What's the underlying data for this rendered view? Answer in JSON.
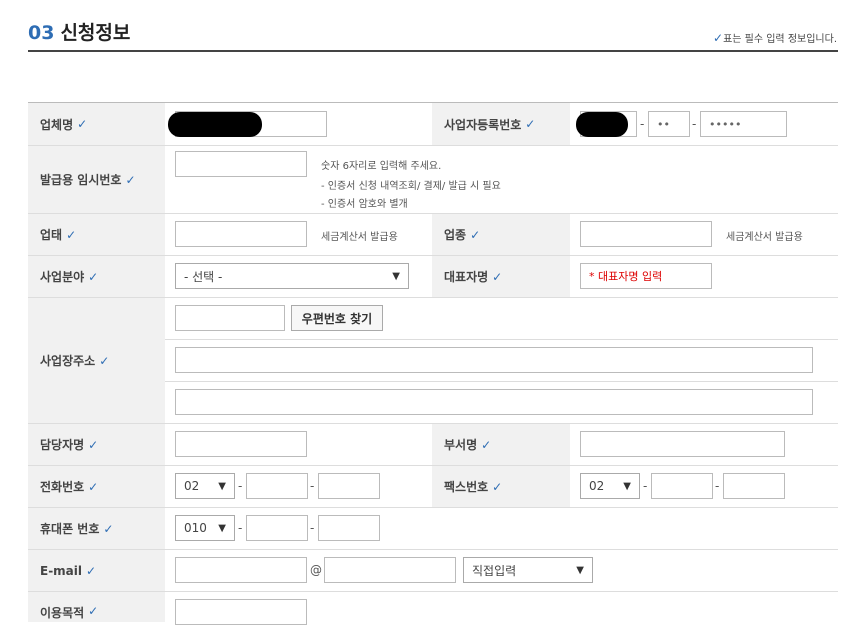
{
  "section": {
    "number": "03",
    "title": "신청정보",
    "required_note": "표는 필수 입력 정보입니다."
  },
  "icons": {
    "check": "✓",
    "chevron": "▼"
  },
  "labels": {
    "company": "업체명",
    "biz_reg": "사업자등록번호",
    "temp_no": "발급용 임시번호",
    "biz_type": "업태",
    "biz_item": "업종",
    "biz_field": "사업분야",
    "ceo": "대표자명",
    "address": "사업장주소",
    "manager": "담당자명",
    "dept": "부서명",
    "phone": "전화번호",
    "fax": "팩스번호",
    "mobile": "휴대폰 번호",
    "email": "E-mail",
    "purpose": "이용목적"
  },
  "fields": {
    "biz_reg_mid": "••",
    "biz_reg_last": "•••••",
    "ceo_placeholder": "* 대표자명 입력",
    "biz_field_select": "- 선택 -",
    "phone_area": "02",
    "fax_area": "02",
    "mobile_prefix": "010",
    "email_domain_select": "직접입력",
    "email_at": "@",
    "sep": "-"
  },
  "notes": {
    "temp_no_1": "숫자 6자리로 입력해 주세요.",
    "temp_no_2": "- 인증서 신청 내역조회/ 결제/ 발급 시 필요",
    "temp_no_3": "- 인증서 암호와 별개",
    "tax_invoice": "세금계산서 발급용"
  },
  "buttons": {
    "zipcode": "우편번호 찾기"
  }
}
